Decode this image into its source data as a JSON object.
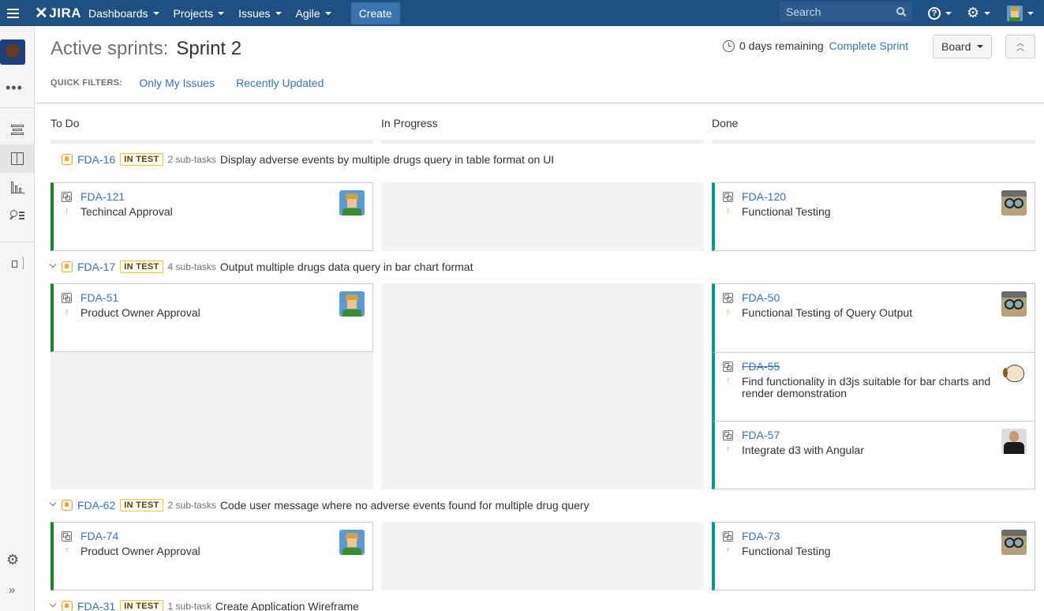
{
  "nav": {
    "logo": "JIRA",
    "items": [
      {
        "label": "Dashboards"
      },
      {
        "label": "Projects"
      },
      {
        "label": "Issues"
      },
      {
        "label": "Agile"
      }
    ],
    "create_label": "Create",
    "search_placeholder": "Search",
    "help_glyph": "?"
  },
  "sidebar": {
    "icons": [
      "backlog-icon",
      "board-icon",
      "reports-icon",
      "issues-icon",
      "megaphone-icon"
    ],
    "more_glyph": "•••",
    "settings_glyph": "⚙",
    "expand_glyph": "»"
  },
  "header": {
    "title_prefix": "Active sprints:",
    "sprint_name": "Sprint 2",
    "remaining": "0 days remaining",
    "complete_sprint": "Complete Sprint",
    "board_label": "Board",
    "quick_filters_label": "QUICK FILTERS:",
    "quick_filters": [
      "Only My Issues",
      "Recently Updated"
    ]
  },
  "columns": [
    "To Do",
    "In Progress",
    "Done"
  ],
  "swimlanes": [
    {
      "key": "FDA-16",
      "status": "IN TEST",
      "subtasks": "2 sub-tasks",
      "summary": "Display adverse events by multiple drugs query in table format on UI",
      "todo": [
        {
          "key": "FDA-121",
          "summary": "Techincal Approval",
          "avatar": "farmer"
        }
      ],
      "done": [
        {
          "key": "FDA-120",
          "summary": "Functional Testing",
          "avatar": "glasses"
        }
      ]
    },
    {
      "key": "FDA-17",
      "status": "IN TEST",
      "subtasks": "4 sub-tasks",
      "summary": "Output multiple drugs data query in bar chart format",
      "todo": [
        {
          "key": "FDA-51",
          "summary": "Product Owner Approval",
          "avatar": "farmer"
        }
      ],
      "done": [
        {
          "key": "FDA-50",
          "summary": "Functional Testing of Query Output",
          "avatar": "glasses"
        },
        {
          "key": "FDA-55",
          "summary": "Find functionality in d3js suitable for bar charts and render demonstration",
          "avatar": "dog",
          "resolved": true
        },
        {
          "key": "FDA-57",
          "summary": "Integrate d3 with Angular",
          "avatar": "suit"
        }
      ]
    },
    {
      "key": "FDA-62",
      "status": "IN TEST",
      "subtasks": "2 sub-tasks",
      "summary": "Code user message where no adverse events found for multiple drug query",
      "todo": [
        {
          "key": "FDA-74",
          "summary": "Product Owner Approval",
          "avatar": "farmer"
        }
      ],
      "done": [
        {
          "key": "FDA-73",
          "summary": "Functional Testing",
          "avatar": "glasses"
        }
      ]
    },
    {
      "key": "FDA-31",
      "status": "IN TEST",
      "subtasks": "1 sub-task",
      "summary": "Create Application Wireframe"
    }
  ],
  "priority_glyph": "↑",
  "colors": {
    "nav": "#205081",
    "link": "#3b73af",
    "todo_border": "#14892c",
    "done_border": "#009c95",
    "badge_border": "#f6c342"
  }
}
